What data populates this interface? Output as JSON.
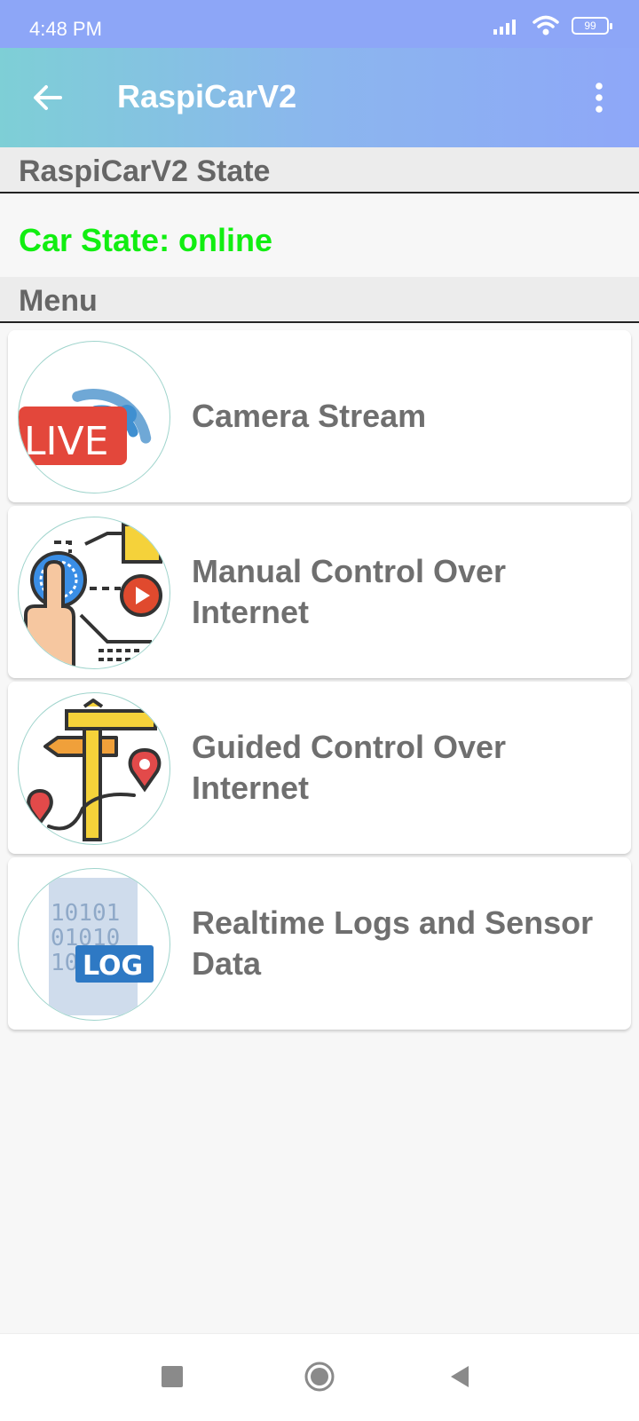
{
  "status_bar": {
    "time": "4:48 PM",
    "battery": "99",
    "icons": [
      "signal-icon",
      "wifi-icon",
      "battery-icon"
    ]
  },
  "app_bar": {
    "title": "RaspiCarV2",
    "back_icon": "arrow-left-icon",
    "menu_icon": "more-vert-icon"
  },
  "state_section": {
    "header": "RaspiCarV2 State",
    "car_state": "Car State: online",
    "car_state_color": "#11ee11"
  },
  "menu_section": {
    "header": "Menu",
    "items": [
      {
        "label": "Camera Stream",
        "icon": "live-stream-icon"
      },
      {
        "label": "Manual Control Over Internet",
        "icon": "touch-control-icon"
      },
      {
        "label": "Guided Control Over Internet",
        "icon": "signpost-map-icon"
      },
      {
        "label": "Realtime Logs and Sensor Data",
        "icon": "log-file-icon"
      }
    ]
  },
  "nav_bar": {
    "icons": [
      "recents-square-icon",
      "home-circle-icon",
      "back-triangle-icon"
    ]
  },
  "colors": {
    "status_bar": "#8da6f7",
    "app_bar_start": "#7ecfd6",
    "app_bar_end": "#8ea7f8",
    "label_gray": "#6f6f6f"
  }
}
